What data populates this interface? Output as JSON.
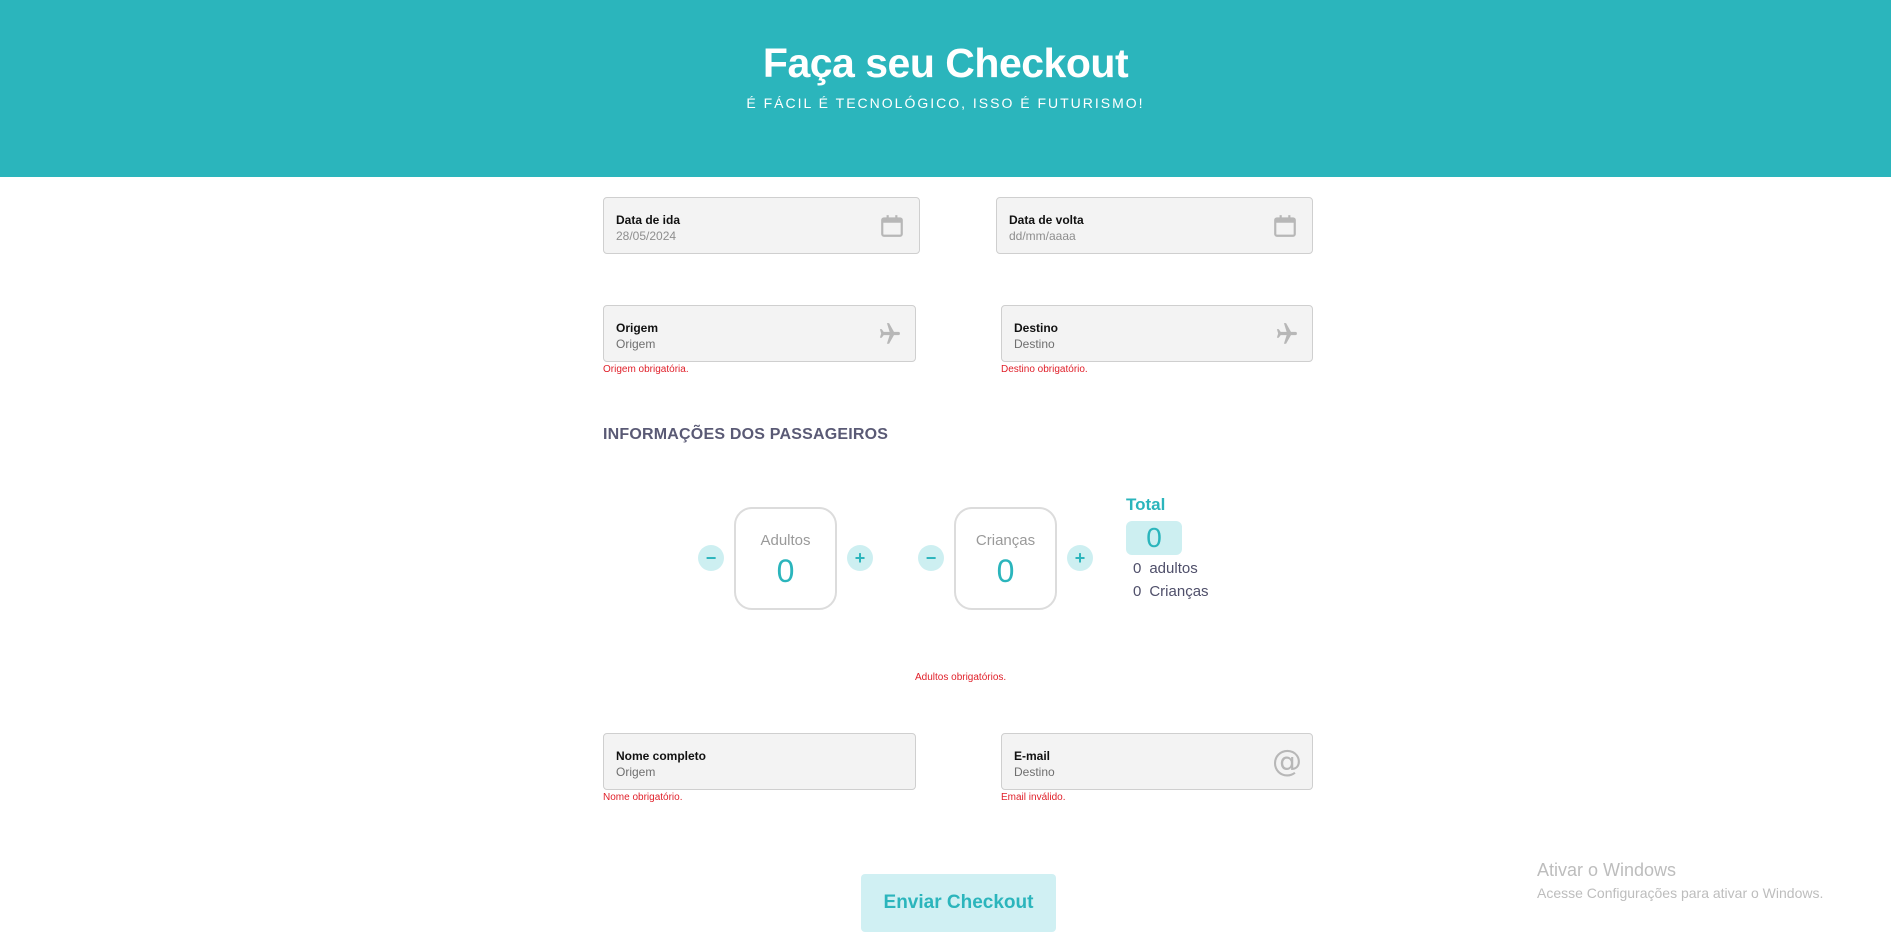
{
  "header": {
    "title": "Faça seu Checkout",
    "subtitle": "É FÁCIL É TECNOLÓGICO, ISSO É FUTURISMO!"
  },
  "dates": {
    "departure_label": "Data de ida",
    "departure_value": "28/05/2024",
    "return_label": "Data de volta",
    "return_placeholder": "dd/mm/aaaa",
    "icon": "calendar-icon"
  },
  "route": {
    "origin_label": "Origem",
    "origin_placeholder": "Origem",
    "origin_error": "Origem obrigatória.",
    "destination_label": "Destino",
    "destination_placeholder": "Destino",
    "destination_error": "Destino obrigatório.",
    "icon": "airplane-icon"
  },
  "passengers": {
    "section_title": "INFORMAÇÕES DOS PASSAGEIROS",
    "minus": "−",
    "plus": "+",
    "adults_label": "Adultos",
    "adults_value": "0",
    "children_label": "Crianças",
    "children_value": "0",
    "total_label": "Total",
    "total_value": "0",
    "summary_adults_count": "0",
    "summary_adults_label": "adultos",
    "summary_children_count": "0",
    "summary_children_label": "Crianças",
    "adults_error": "Adultos obrigatórios."
  },
  "contact": {
    "name_label": "Nome completo",
    "name_placeholder": "Origem",
    "name_error": "Nome obrigatório.",
    "email_label": "E-mail",
    "email_placeholder": "Destino",
    "email_error": "Email inválido.",
    "email_icon_glyph": "@"
  },
  "submit": {
    "label": "Enviar Checkout"
  },
  "watermark": {
    "title": "Ativar o Windows",
    "subtitle": "Acesse Configurações para ativar o Windows."
  },
  "colors": {
    "primary": "#2bb5bc",
    "primary_light": "#cdeff1",
    "error": "#e0202a",
    "field_bg": "#f3f3f3"
  }
}
